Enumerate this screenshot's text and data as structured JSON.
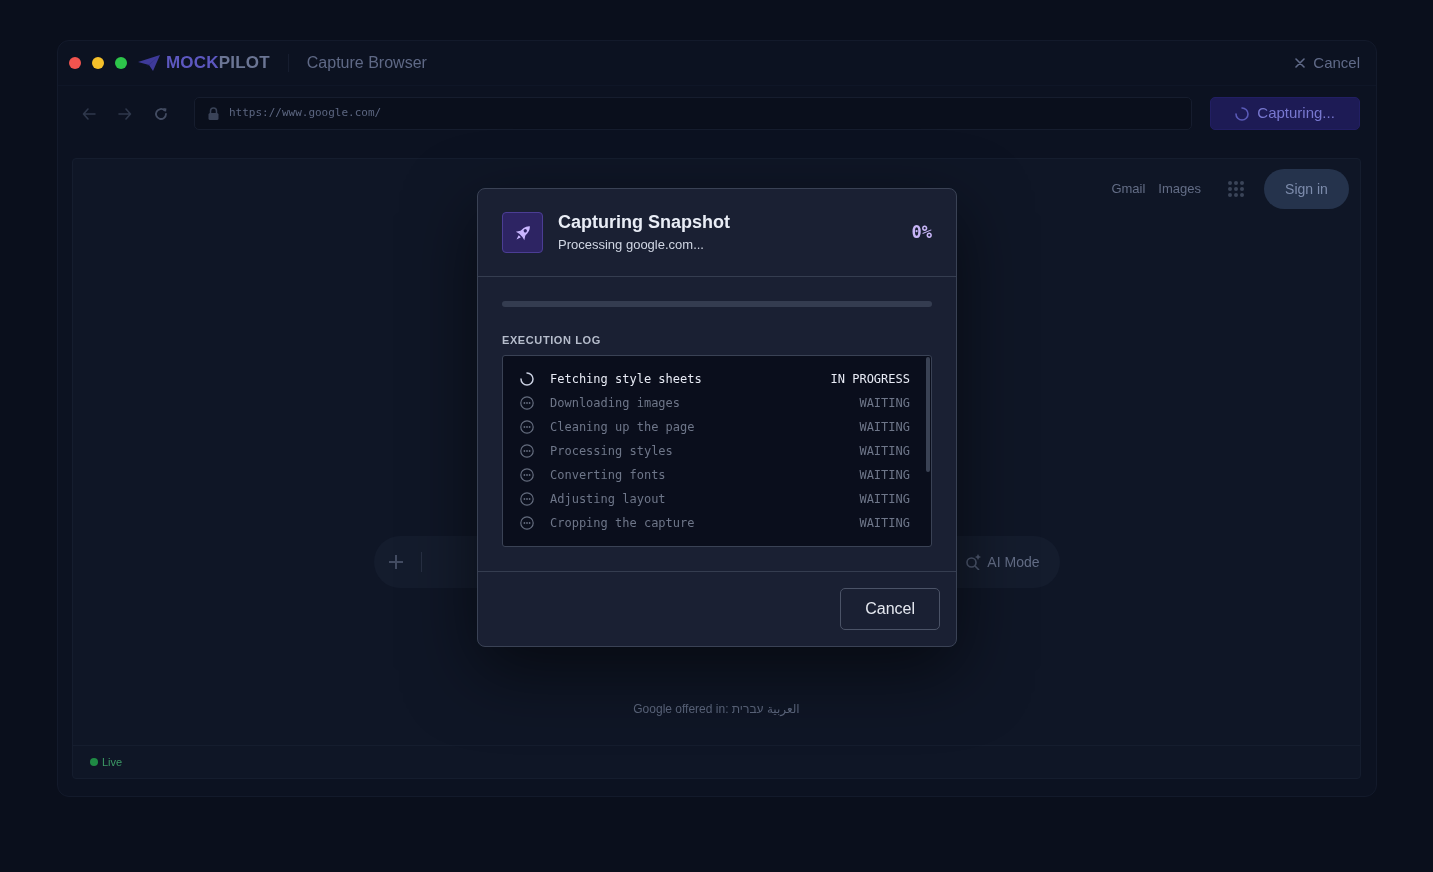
{
  "app_bar": {
    "brand": {
      "first": "MOCK",
      "second": "PILOT"
    },
    "title": "Capture Browser",
    "cancel_label": "Cancel"
  },
  "toolbar": {
    "url": "https://www.google.com/",
    "capture_button": "Capturing..."
  },
  "web_page": {
    "links": [
      "Gmail",
      "Images"
    ],
    "sign_in": "Sign in",
    "search": {
      "mode_label": "AI Mode"
    },
    "language_offer": {
      "text": "Google offered in:",
      "languages": [
        "العربية",
        "עברית"
      ]
    }
  },
  "status_bar": {
    "status": "Live"
  },
  "dialog": {
    "title": "Capturing Snapshot",
    "subtitle": "Processing google.com...",
    "percent": "0%",
    "log_title": "EXECUTION LOG",
    "log": [
      {
        "task": "Fetching style sheets",
        "status": "IN PROGRESS",
        "kind": "running"
      },
      {
        "task": "Downloading images",
        "status": "WAITING",
        "kind": "waiting"
      },
      {
        "task": "Cleaning up the page",
        "status": "WAITING",
        "kind": "waiting"
      },
      {
        "task": "Processing styles",
        "status": "WAITING",
        "kind": "waiting"
      },
      {
        "task": "Converting fonts",
        "status": "WAITING",
        "kind": "waiting"
      },
      {
        "task": "Adjusting layout",
        "status": "WAITING",
        "kind": "waiting"
      },
      {
        "task": "Cropping the capture",
        "status": "WAITING",
        "kind": "waiting"
      }
    ],
    "buttons": [
      "Cancel"
    ]
  }
}
